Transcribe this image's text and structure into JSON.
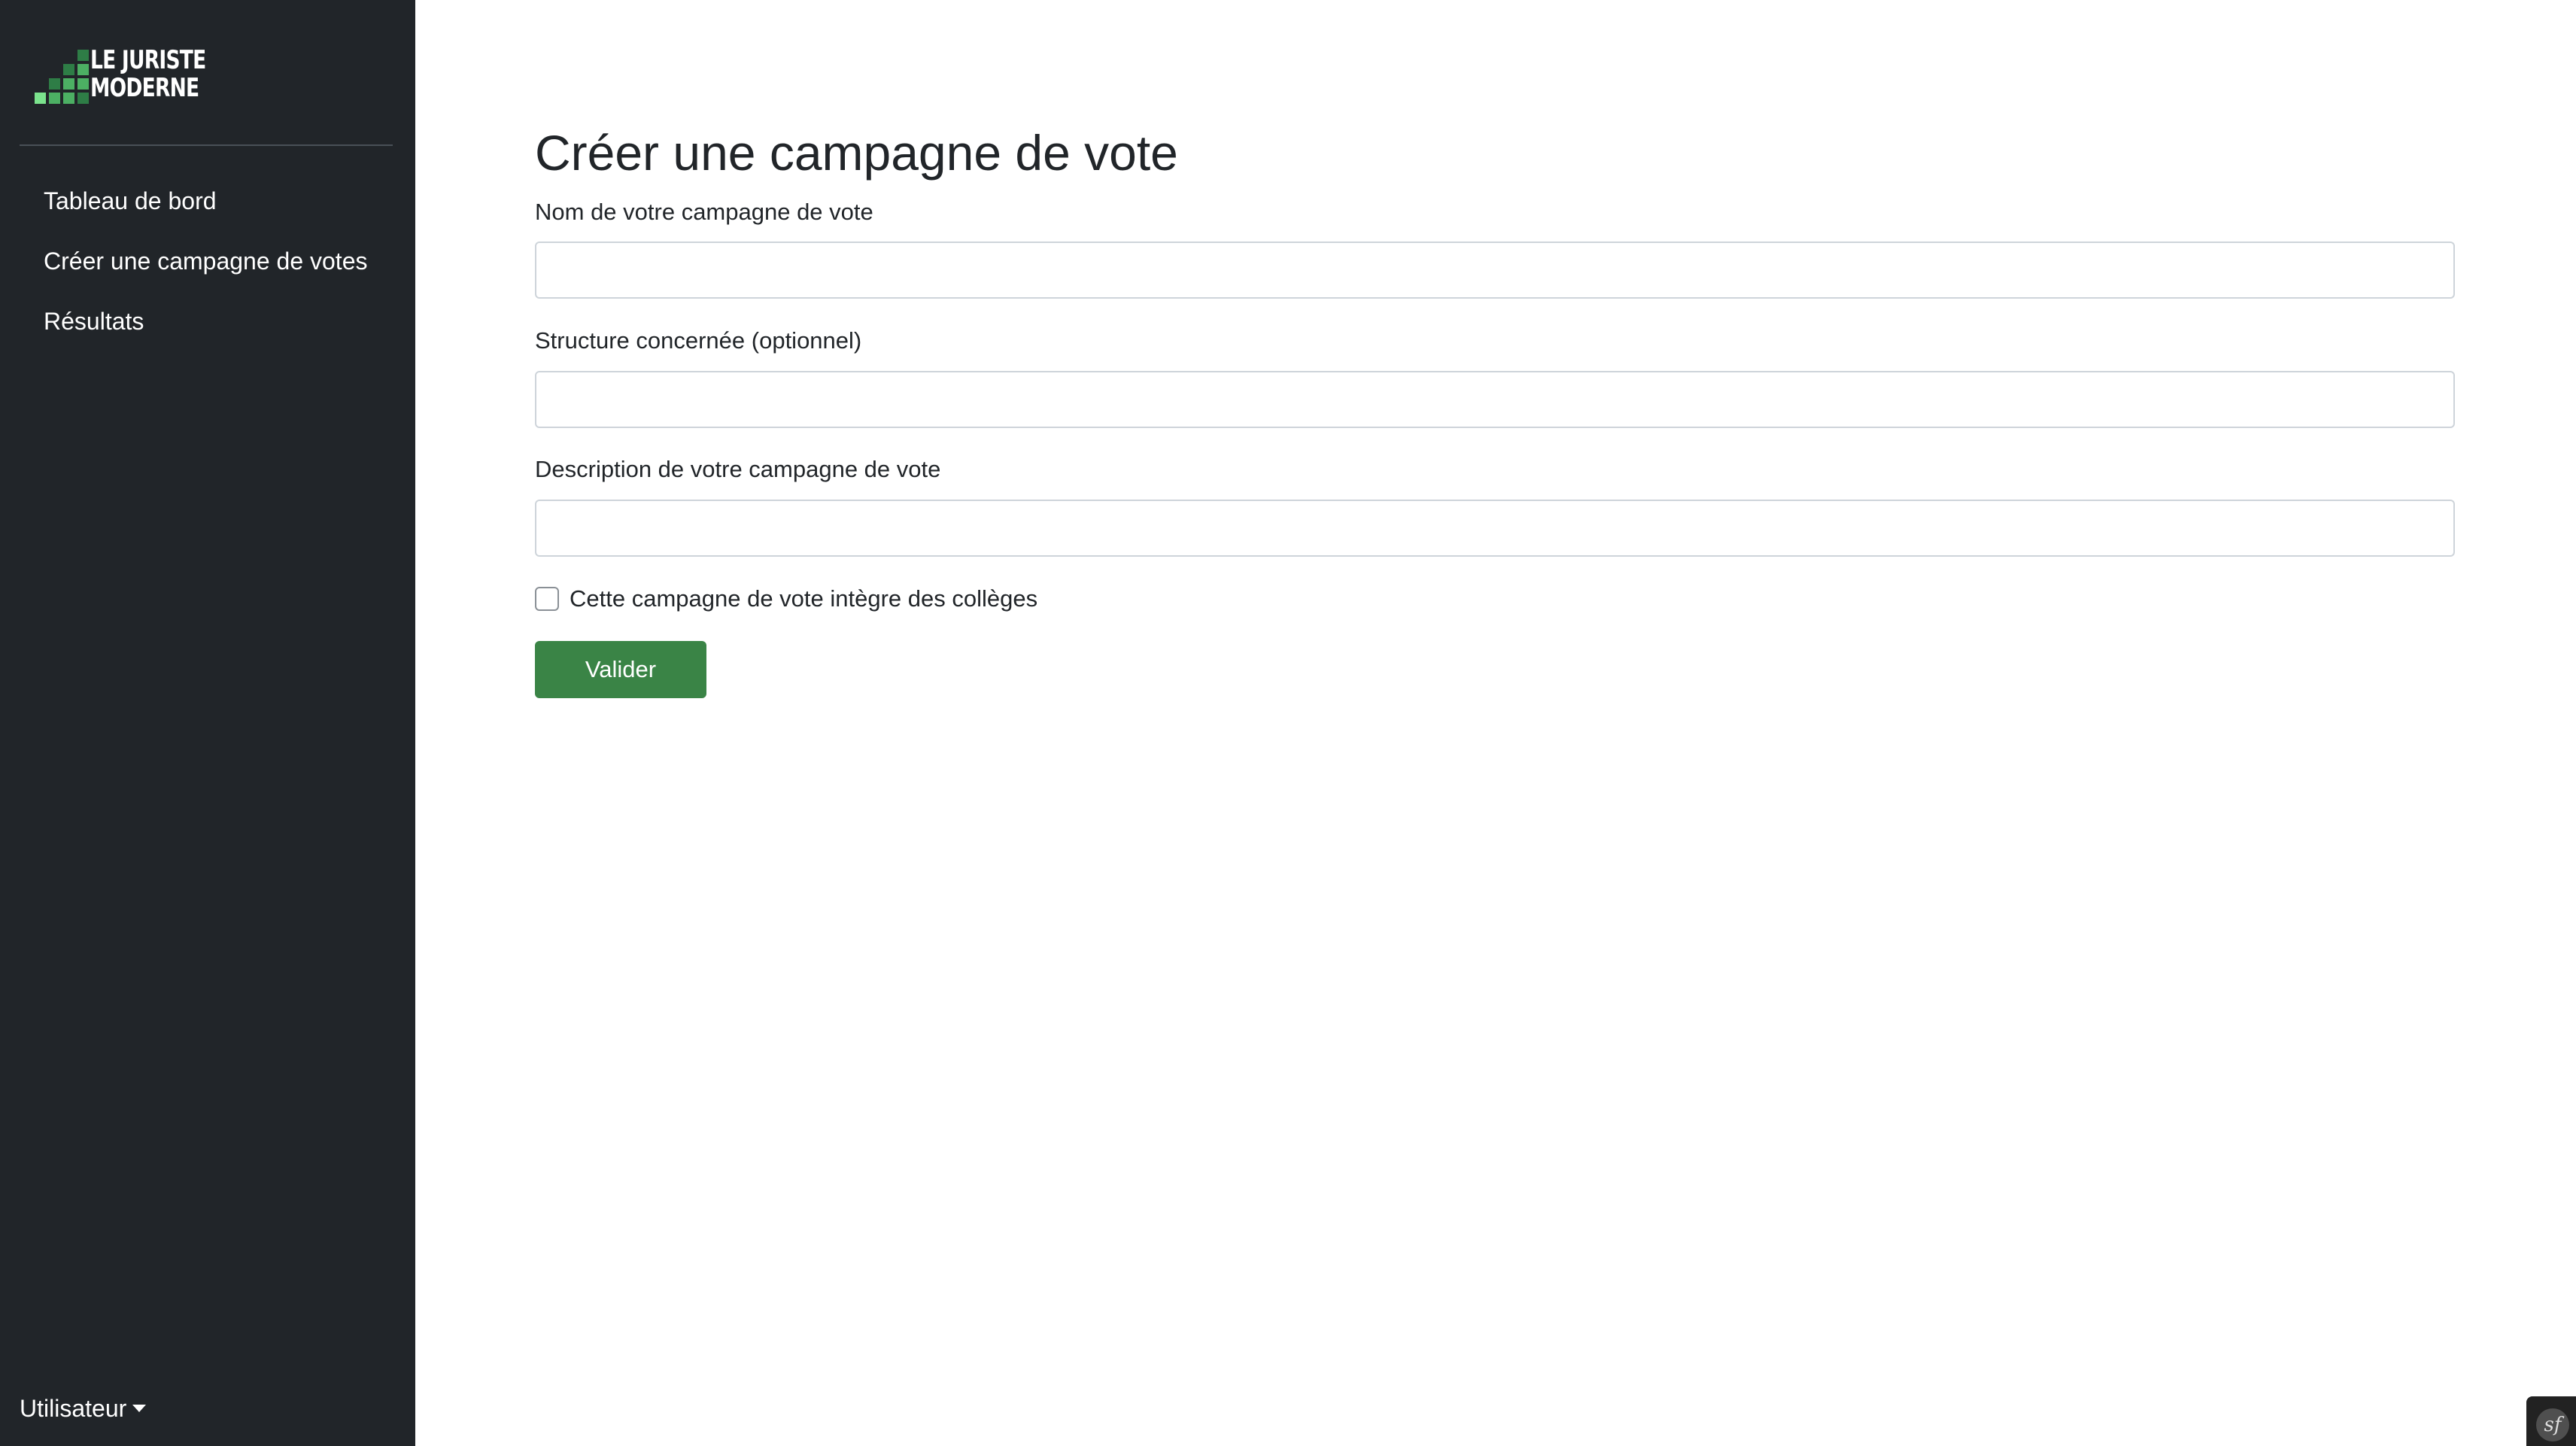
{
  "brand": {
    "logo_line1": "LE JURISTE",
    "logo_line2": "MODERNE",
    "logo_colors": [
      "#2e7d46",
      "#4caf63",
      "#7be38d"
    ]
  },
  "sidebar": {
    "items": [
      {
        "label": "Tableau de bord"
      },
      {
        "label": "Créer une campagne de votes"
      },
      {
        "label": "Résultats"
      }
    ],
    "user_menu_label": "Utilisateur"
  },
  "form": {
    "title": "Créer une campagne de vote",
    "fields": [
      {
        "label": "Nom de votre campagne de vote",
        "value": "",
        "placeholder": ""
      },
      {
        "label": "Structure concernée (optionnel)",
        "value": "",
        "placeholder": ""
      },
      {
        "label": "Description de votre campagne de vote",
        "value": "",
        "placeholder": ""
      }
    ],
    "checkbox": {
      "label": "Cette campagne de vote intègre des collèges",
      "checked": false
    },
    "submit_label": "Valider"
  },
  "debug_toolbar": {
    "icon": "symfony-icon",
    "glyph": "sf"
  },
  "colors": {
    "sidebar_bg": "#212529",
    "button_green": "#3a8446",
    "text": "#212529"
  }
}
